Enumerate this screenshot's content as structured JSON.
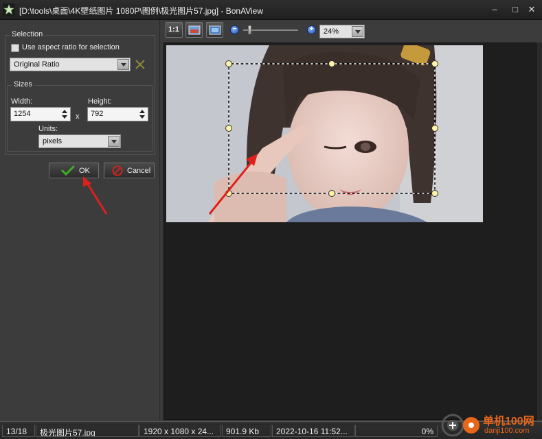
{
  "window": {
    "title": "[D:\\tools\\桌面\\4K壁纸图片 1080P\\图例\\极光图片57.jpg] - BonAView",
    "minimize_glyph": "‒",
    "maximize_glyph": "□",
    "close_glyph": "✕"
  },
  "selection": {
    "group_label": "Selection",
    "aspect_checkbox_label": "Use aspect ratio for selection",
    "aspect_checked": false,
    "ratio_value": "Original Ratio"
  },
  "sizes": {
    "group_label": "Sizes",
    "width_label": "Width:",
    "width_value": "1254",
    "times_label": "x",
    "height_label": "Height:",
    "height_value": "792",
    "units_label": "Units:",
    "units_value": "pixels"
  },
  "actions": {
    "ok_label": "OK",
    "cancel_label": "Cancel"
  },
  "toolbar": {
    "actual_size_label": "1:1",
    "zoom_value": "24%",
    "zoom_out_glyph": "−",
    "zoom_in_glyph": "+",
    "zoom_level_fraction": 0.24
  },
  "status": {
    "position": "13/18",
    "filename": "极光图片57.jpg",
    "dimensions": "1920 x 1080 x 24...",
    "filesize": "901.9 Kb",
    "datetime": "2022-10-16 11:52...",
    "progress": "0%"
  },
  "watermark": {
    "text": "单机100网",
    "url": "danji100.com"
  },
  "colors": {
    "arrow": "#e0201b",
    "handle_fill": "#fff3a8",
    "ok_check": "#3fae2a",
    "cancel_icon": "#d22222"
  },
  "icons": {
    "app": "star-icon",
    "dismiss": "x-mark-icon",
    "ok": "checkmark-icon",
    "cancel": "no-entry-icon"
  }
}
